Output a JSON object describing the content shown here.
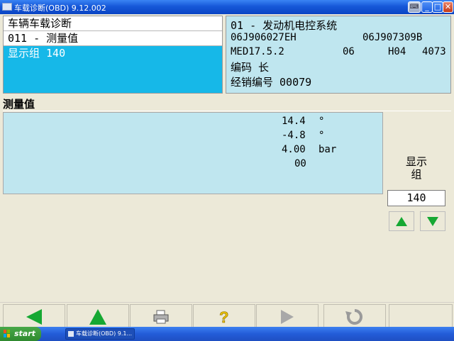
{
  "window": {
    "title": "车载诊断(OBD) 9.12.002",
    "controls": {
      "keyboard": "⌨",
      "minimize": "_",
      "maximize": "□",
      "close": "✕"
    }
  },
  "header_left": {
    "title": "车辆车载诊断",
    "function": "011 - 测量值",
    "group": "显示组 140"
  },
  "header_right": {
    "system": "01 - 发动机电控系统",
    "part_number": "06J906027EH",
    "part_number_2": "06J907309B",
    "ecu_model": "MED17.5.2",
    "ecu_code_1": "06",
    "ecu_code_2": "H04",
    "ecu_code_3": "4073",
    "coding": "编码 长",
    "dealer": "经销编号 00079"
  },
  "measurements": {
    "title": "测量值",
    "rows": [
      {
        "value": "14.4",
        "unit": "°"
      },
      {
        "value": "-4.8",
        "unit": "°"
      },
      {
        "value": "4.00",
        "unit": "bar"
      },
      {
        "value": "00",
        "unit": ""
      }
    ]
  },
  "group_selector": {
    "label_line1": "显示",
    "label_line2": "组",
    "value": "140",
    "up_icon": "green-up-triangle",
    "down_icon": "green-down-triangle"
  },
  "toolbar": {
    "buttons": [
      {
        "icon": "back-arrow-icon",
        "enabled": true
      },
      {
        "icon": "up-arrow-icon",
        "enabled": true
      },
      {
        "icon": "printer-icon",
        "enabled": true
      },
      {
        "icon": "help-icon",
        "enabled": true
      },
      {
        "icon": "play-icon",
        "enabled": false
      },
      {
        "icon": "refresh-icon",
        "enabled": false
      }
    ]
  },
  "taskbar": {
    "start_label": "start",
    "task_label": "车载诊断(OBD) 9.1..."
  },
  "colors": {
    "selection": "#16b8e8",
    "panel_bg": "#bfe6ef",
    "window_bg": "#ece9d8",
    "accent_green": "#16a833",
    "titlebar_blue": "#0a44c4"
  }
}
